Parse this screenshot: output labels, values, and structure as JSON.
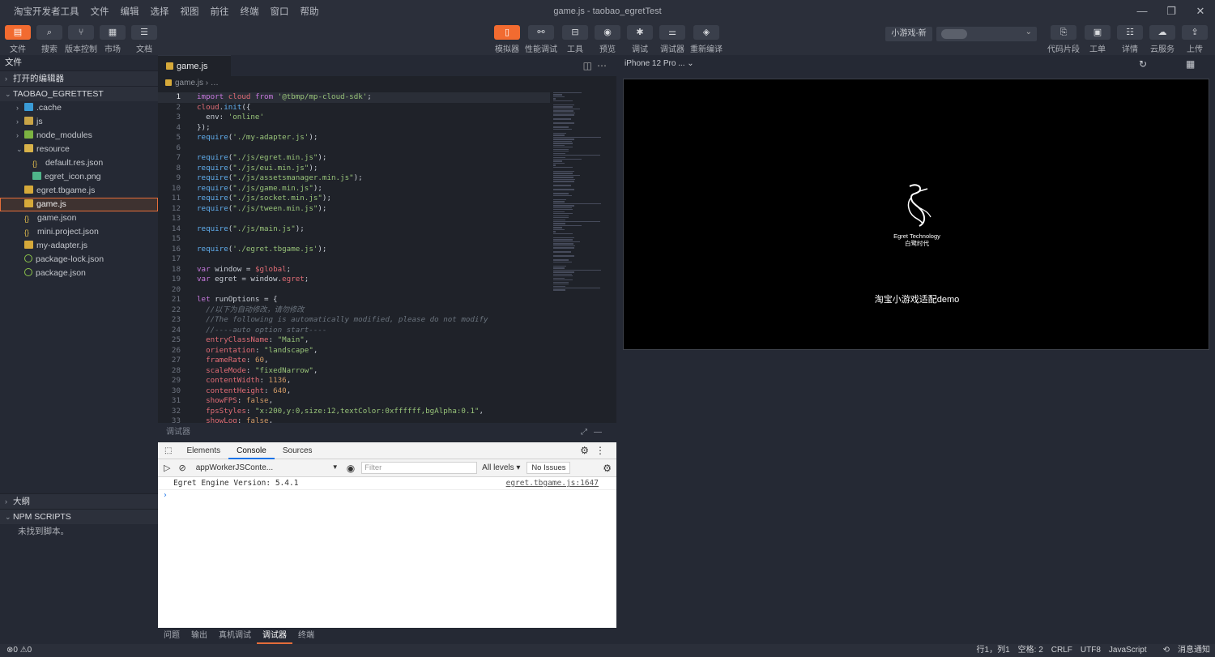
{
  "window": {
    "title": "game.js - taobao_egretTest",
    "controls": [
      "—",
      "❐",
      "✕"
    ]
  },
  "menu": [
    "淘宝开发者工具",
    "文件",
    "编辑",
    "选择",
    "视图",
    "前往",
    "终端",
    "窗口",
    "帮助"
  ],
  "toolbar_left": [
    {
      "icon": "file-icon",
      "glyph": "▤",
      "label": "文件",
      "active": true
    },
    {
      "icon": "search-icon",
      "glyph": "⌕",
      "label": "搜索",
      "active": false
    },
    {
      "icon": "branch-icon",
      "glyph": "⑂",
      "label": "版本控制",
      "active": false
    },
    {
      "icon": "grid-icon",
      "glyph": "▦",
      "label": "市场",
      "active": false
    },
    {
      "icon": "doc-icon",
      "glyph": "☰",
      "label": "文档",
      "active": false
    }
  ],
  "toolbar_center": [
    {
      "icon": "phone-icon",
      "glyph": "▯",
      "label": "模拟器",
      "active": true
    },
    {
      "icon": "perf-icon",
      "glyph": "⚯",
      "label": "性能调试",
      "active": false
    },
    {
      "icon": "toolbox-icon",
      "glyph": "⊟",
      "label": "工具",
      "active": false
    },
    {
      "icon": "eye-icon",
      "glyph": "◉",
      "label": "预览",
      "active": false
    },
    {
      "icon": "bug-icon",
      "glyph": "✱",
      "label": "调试",
      "active": false
    },
    {
      "icon": "sliders-icon",
      "glyph": "⚌",
      "label": "调试器",
      "active": false
    },
    {
      "icon": "layers-icon",
      "glyph": "◈",
      "label": "重新编译",
      "active": false
    }
  ],
  "toolbar_right": [
    {
      "icon": "snippet-icon",
      "glyph": "⎘",
      "label": "代码片段"
    },
    {
      "icon": "ticket-icon",
      "glyph": "▣",
      "label": "工单"
    },
    {
      "icon": "list-icon",
      "glyph": "☷",
      "label": "详情"
    },
    {
      "icon": "cloud-icon",
      "glyph": "☁",
      "label": "云服务"
    },
    {
      "icon": "upload-icon",
      "glyph": "⇪",
      "label": "上传"
    }
  ],
  "mode_label": "小游戏-新",
  "sidebar": {
    "title": "文件",
    "open_editors": "打开的编辑器",
    "project": "TAOBAO_EGRETTEST",
    "tree": [
      {
        "label": ".cache",
        "indent": 1,
        "arrow": "›",
        "type": "cache"
      },
      {
        "label": "js",
        "indent": 1,
        "arrow": "›",
        "type": "folder"
      },
      {
        "label": "node_modules",
        "indent": 1,
        "arrow": "›",
        "type": "node"
      },
      {
        "label": "resource",
        "indent": 1,
        "arrow": "⌄",
        "type": "res"
      },
      {
        "label": "default.res.json",
        "indent": 2,
        "arrow": "",
        "type": "json"
      },
      {
        "label": "egret_icon.png",
        "indent": 2,
        "arrow": "",
        "type": "png"
      },
      {
        "label": "egret.tbgame.js",
        "indent": 1,
        "arrow": "",
        "type": "js"
      },
      {
        "label": "game.js",
        "indent": 1,
        "arrow": "",
        "type": "js",
        "selected": true
      },
      {
        "label": "game.json",
        "indent": 1,
        "arrow": "",
        "type": "json"
      },
      {
        "label": "mini.project.json",
        "indent": 1,
        "arrow": "",
        "type": "json"
      },
      {
        "label": "my-adapter.js",
        "indent": 1,
        "arrow": "",
        "type": "js"
      },
      {
        "label": "package-lock.json",
        "indent": 1,
        "arrow": "",
        "type": "pkg"
      },
      {
        "label": "package.json",
        "indent": 1,
        "arrow": "",
        "type": "pkg"
      }
    ],
    "outline": "大纲",
    "npm_scripts": "NPM SCRIPTS",
    "npm_empty": "未找到脚本。"
  },
  "editor": {
    "tab": "game.js",
    "breadcrumb": "game.js  ›  …",
    "lines": [
      "<span class=kw>import</span> <span class=pr>cloud</span> <span class=kw>from</span> <span class=str>'@tbmp/mp-cloud-sdk'</span>;",
      "<span class=pr>cloud</span>.<span class=fn>init</span>({",
      "  env: <span class=str>'online'</span>",
      "});",
      "<span class=fn>require</span>(<span class=str>'./my-adapter.js'</span>);",
      "",
      "<span class=fn>require</span>(<span class=str>\"./js/egret.min.js\"</span>);",
      "<span class=fn>require</span>(<span class=str>\"./js/eui.min.js\"</span>);",
      "<span class=fn>require</span>(<span class=str>\"./js/assetsmanager.min.js\"</span>);",
      "<span class=fn>require</span>(<span class=str>\"./js/game.min.js\"</span>);",
      "<span class=fn>require</span>(<span class=str>\"./js/socket.min.js\"</span>);",
      "<span class=fn>require</span>(<span class=str>\"./js/tween.min.js\"</span>);",
      "",
      "<span class=fn>require</span>(<span class=str>\"./js/main.js\"</span>);",
      "",
      "<span class=fn>require</span>(<span class=str>'./egret.tbgame.js'</span>);",
      "",
      "<span class=kw>var</span> window = <span class=pr>$global</span>;",
      "<span class=kw>var</span> egret = window.<span class=pr>egret</span>;",
      "",
      "<span class=kw>let</span> runOptions = {",
      "  <span class=cm>//以下为自动修改，请勿修改</span>",
      "  <span class=cm>//The following is automatically modified, please do not modify</span>",
      "  <span class=cm>//----auto option start----</span>",
      "  <span class=pr>entryClassName</span>: <span class=str>\"Main\"</span>,",
      "  <span class=pr>orientation</span>: <span class=str>\"landscape\"</span>,",
      "  <span class=pr>frameRate</span>: <span class=nu>60</span>,",
      "  <span class=pr>scaleMode</span>: <span class=str>\"fixedNarrow\"</span>,",
      "  <span class=pr>contentWidth</span>: <span class=nu>1136</span>,",
      "  <span class=pr>contentHeight</span>: <span class=nu>640</span>,",
      "  <span class=pr>showFPS</span>: <span class=nu>false</span>,",
      "  <span class=pr>fpsStyles</span>: <span class=str>\"x:200,y:0,size:12,textColor:0xffffff,bgAlpha:0.1\"</span>,",
      "  <span class=pr>showLog</span>: <span class=nu>false</span>,"
    ]
  },
  "debugger": {
    "title": "调试器",
    "tabs": [
      "Elements",
      "Console",
      "Sources"
    ],
    "context": "appWorkerJSConte...",
    "filter_placeholder": "Filter",
    "levels": "All levels ▾",
    "issues": "No Issues",
    "log_message": "Egret Engine Version: 5.4.1",
    "log_source": "egret.tbgame.js:1647",
    "prompt": "›"
  },
  "bottom_tabs": [
    "问题",
    "输出",
    "真机调试",
    "调试器",
    "终端"
  ],
  "simulator": {
    "device": "iPhone 12 Pro ...",
    "brand_line1": "Egret Technology",
    "brand_line2": "白鹭时代",
    "game_text": "淘宝小游戏适配demo"
  },
  "status": {
    "left": "⊗0 ⚠0",
    "position": "行1，列1",
    "indent": "空格: 2",
    "eol": "CRLF",
    "encoding": "UTF8",
    "language": "JavaScript",
    "notify": "消息通知"
  }
}
